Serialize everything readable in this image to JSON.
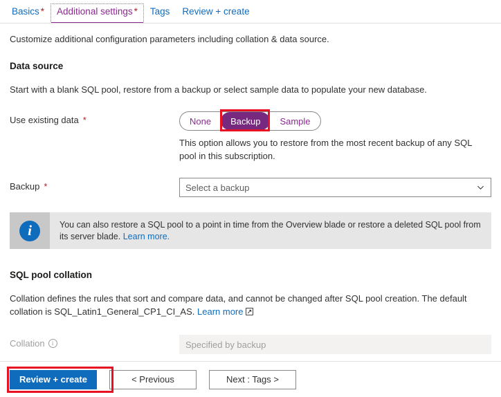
{
  "tabs": [
    {
      "label": "Basics",
      "required": "*",
      "active": false
    },
    {
      "label": "Additional settings",
      "required": "*",
      "active": true
    },
    {
      "label": "Tags",
      "required": "",
      "active": false
    },
    {
      "label": "Review + create",
      "required": "",
      "active": false
    }
  ],
  "page": {
    "lede": "Customize additional configuration parameters including collation & data source."
  },
  "data_source": {
    "heading": "Data source",
    "description": "Start with a blank SQL pool, restore from a backup or select sample data to populate your new database.",
    "use_existing_data": {
      "label": "Use existing data",
      "required": "*",
      "options": [
        "None",
        "Backup",
        "Sample"
      ],
      "selected": "Backup",
      "helper": "This option allows you to restore from the most recent backup of any SQL pool in this subscription."
    },
    "backup": {
      "label": "Backup",
      "required": "*",
      "placeholder": "Select a backup",
      "value": "Select a backup",
      "chevron_icon": "chevron-down-icon"
    }
  },
  "info_banner": {
    "icon": "info-circle-icon",
    "icon_glyph": "i",
    "text": "You can also restore a SQL pool to a point in time from the Overview blade or restore a deleted SQL pool from its server blade.",
    "link_label": "Learn more."
  },
  "collation_section": {
    "heading": "SQL pool collation",
    "description": "Collation defines the rules that sort and compare data, and cannot be changed after SQL pool creation. The default collation is SQL_Latin1_General_CP1_CI_AS.",
    "link_label": "Learn more",
    "link_icon": "external-link-icon",
    "collation_field": {
      "label": "Collation",
      "info_icon": "info-tooltip-icon",
      "value": "Specified by backup",
      "disabled": true
    }
  },
  "footer": {
    "review_create_label": "Review + create",
    "previous_label": "< Previous",
    "next_label": "Next : Tags >"
  },
  "colors": {
    "accent_blue": "#0f6cbd",
    "selected_purple": "#76297f",
    "highlight_red": "#e81123",
    "required_red": "#a4262c",
    "banner_grey": "#e6e6e6",
    "banner_icon_grey": "#c8c8c8"
  }
}
